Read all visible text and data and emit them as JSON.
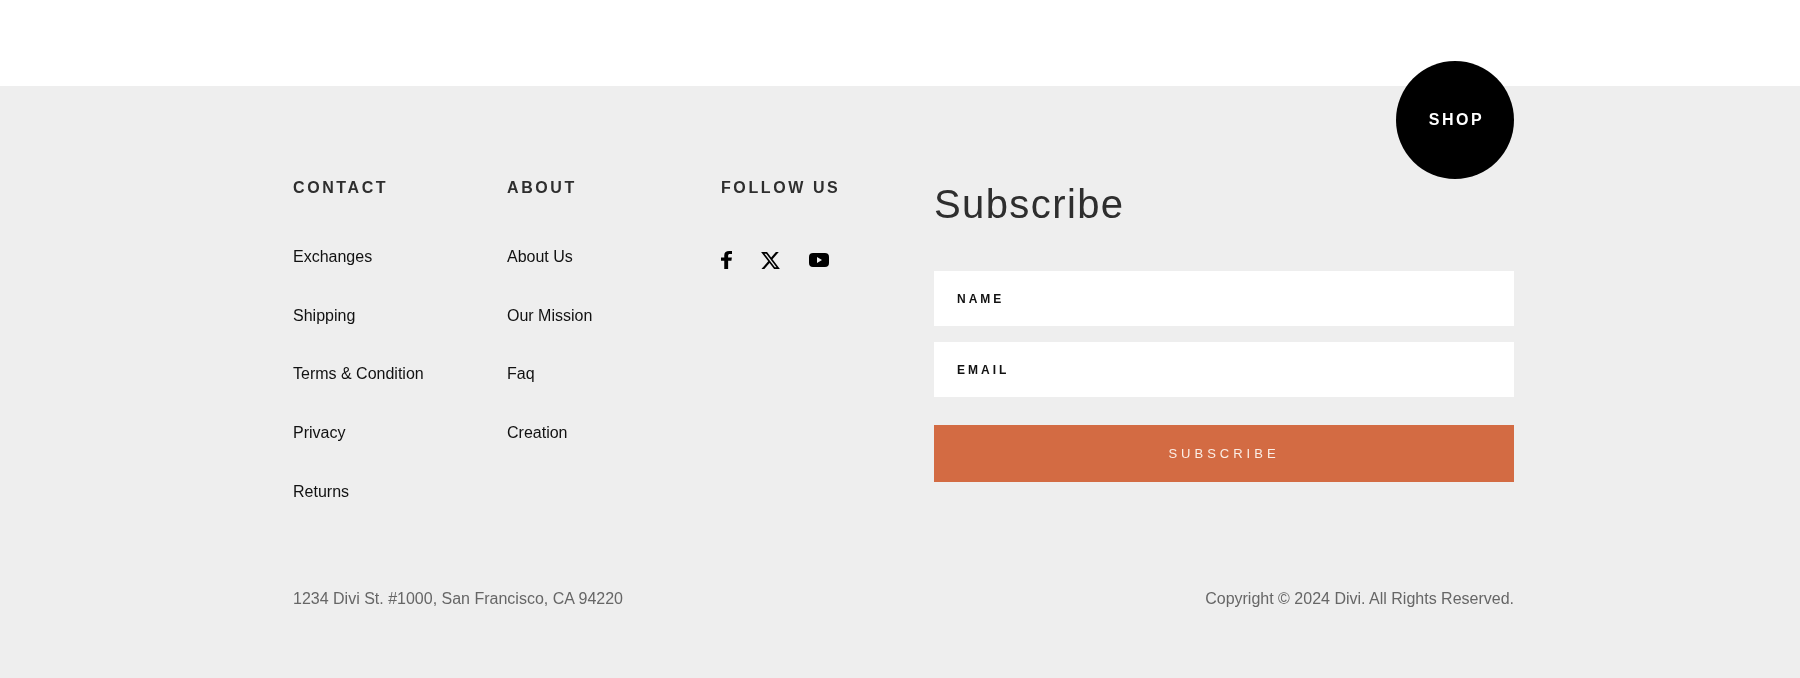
{
  "shop_button": {
    "label": "SHOP"
  },
  "columns": [
    {
      "heading": "CONTACT",
      "links": [
        "Exchanges",
        "Shipping",
        "Terms & Condition",
        "Privacy",
        "Returns"
      ]
    },
    {
      "heading": "ABOUT",
      "links": [
        "About Us",
        "Our Mission",
        "Faq",
        "Creation"
      ]
    }
  ],
  "follow": {
    "heading": "FOLLOW US",
    "social": [
      {
        "kind": "facebook"
      },
      {
        "kind": "x"
      },
      {
        "kind": "youtube"
      }
    ]
  },
  "subscribe": {
    "title": "Subscribe",
    "fields": [
      {
        "placeholder": "NAME"
      },
      {
        "placeholder": "EMAIL"
      }
    ],
    "button": "SUBSCRIBE"
  },
  "bottom": {
    "address": "1234 Divi St. #1000, San Francisco, CA 94220",
    "copyright": "Copyright © 2024 Divi. All Rights Reserved."
  }
}
